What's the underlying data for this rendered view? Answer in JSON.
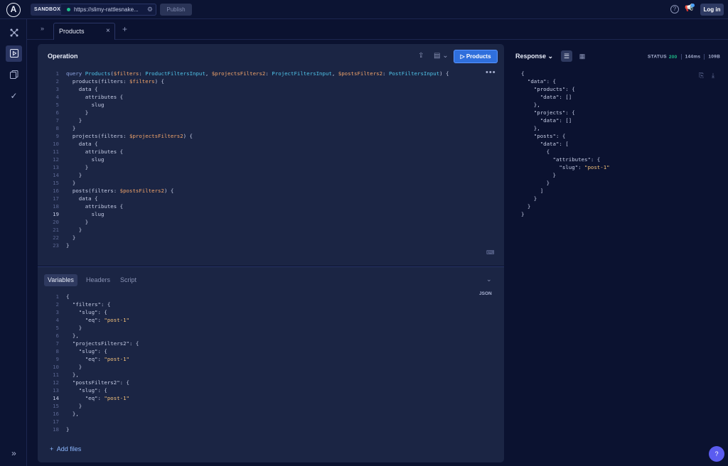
{
  "topbar": {
    "logo": "A",
    "sandbox_label": "SANDBOX",
    "url": "https://slimy-rattlesnake...",
    "publish_label": "Publish",
    "help_label": "?",
    "login_label": "Log in"
  },
  "tabs": {
    "expand": "»",
    "active_tab": "Products",
    "close": "×",
    "add": "+"
  },
  "operation": {
    "title": "Operation",
    "run_label": "▷ Products",
    "more": "•••",
    "keyboard": "⌨",
    "lines": [
      "query Products($filters: ProductFiltersInput, $projectsFilters2: ProjectFiltersInput, $postsFilters2: PostFiltersInput) {",
      "  products(filters: $filters) {",
      "    data {",
      "      attributes {",
      "        slug",
      "      }",
      "    }",
      "  }",
      "  projects(filters: $projectsFilters2) {",
      "    data {",
      "      attributes {",
      "        slug",
      "      }",
      "    }",
      "  }",
      "  posts(filters: $postsFilters2) {",
      "    data {",
      "      attributes {",
      "        slug",
      "      }",
      "    }",
      "  }",
      "}"
    ]
  },
  "variables": {
    "tabs": [
      "Variables",
      "Headers",
      "Script"
    ],
    "json_label": "JSON",
    "add_files": "Add files",
    "lines": [
      "{",
      "  \"filters\": {",
      "    \"slug\": {",
      "      \"eq\": \"post-1\"",
      "    }",
      "  },",
      "  \"projectsFilters2\": {",
      "    \"slug\": {",
      "      \"eq\": \"post-1\"",
      "    }",
      "  },",
      "  \"postsFilters2\": {",
      "    \"slug\": {",
      "      \"eq\": \"post-1\"",
      "    }",
      "  },",
      "",
      "}"
    ]
  },
  "response": {
    "title": "Response",
    "status_label": "STATUS",
    "status_code": "200",
    "time": "144ms",
    "size": "109B",
    "lines": [
      "{",
      "  \"data\": {",
      "    \"products\": {",
      "      \"data\": []",
      "    },",
      "    \"projects\": {",
      "      \"data\": []",
      "    },",
      "    \"posts\": {",
      "      \"data\": [",
      "        {",
      "          \"attributes\": {",
      "            \"slug\": \"post-1\"",
      "          }",
      "        }",
      "      ]",
      "    }",
      "  }",
      "}"
    ]
  },
  "help_fab": "?"
}
